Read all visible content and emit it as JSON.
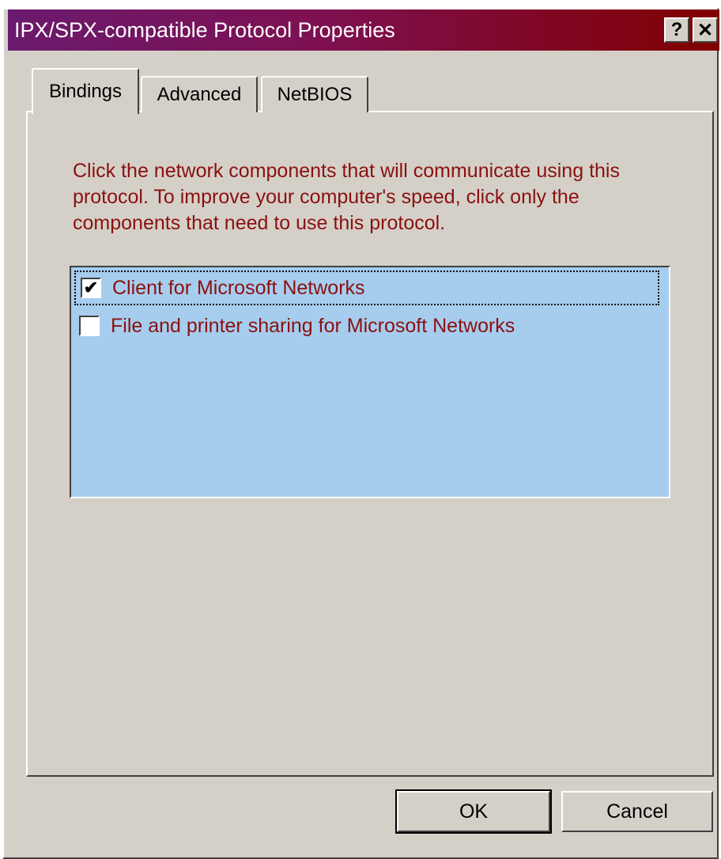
{
  "window": {
    "title": "IPX/SPX-compatible Protocol Properties",
    "help_glyph": "?",
    "close_glyph": "✕"
  },
  "tabs": [
    {
      "label": "Bindings",
      "active": true
    },
    {
      "label": "Advanced",
      "active": false
    },
    {
      "label": "NetBIOS",
      "active": false
    }
  ],
  "bindings": {
    "description": "Click the network components that will communicate using this protocol. To improve your computer's speed, click only the components that need to use this protocol.",
    "items": [
      {
        "label": "Client for Microsoft Networks",
        "checked": true,
        "check_glyph": "✔"
      },
      {
        "label": "File and printer sharing for Microsoft Networks",
        "checked": false,
        "check_glyph": ""
      }
    ]
  },
  "buttons": {
    "ok": "OK",
    "cancel": "Cancel"
  },
  "colors": {
    "title_gradient_start": "#6b1a6e",
    "title_gradient_end": "#800000",
    "dialog_face": "#d4d0c8",
    "list_background": "#a6cdee",
    "text_accent": "#8b1010"
  }
}
